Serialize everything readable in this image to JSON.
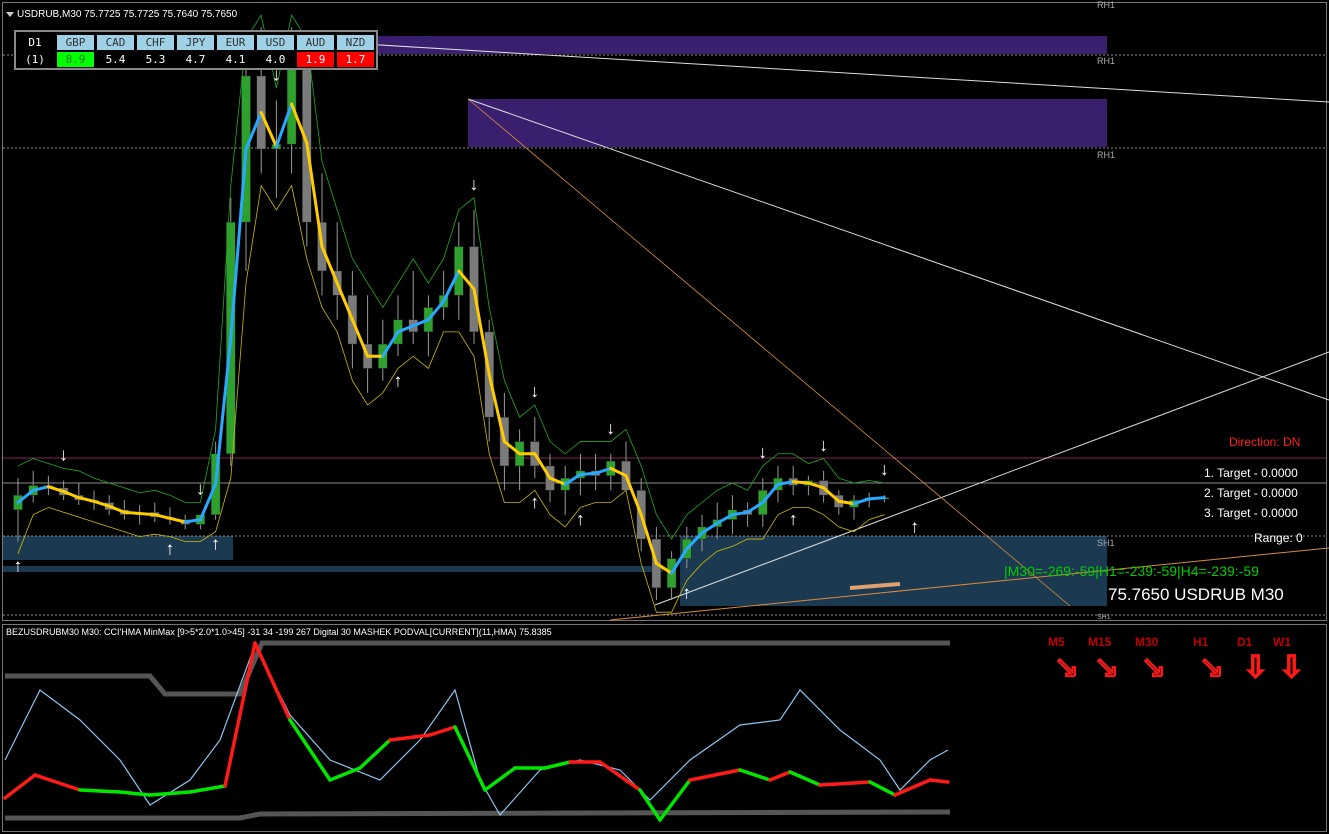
{
  "chart_header": {
    "symbol_line": "USDRUB,M30  75.7725 75.7725 75.7640 75.7650"
  },
  "strength_table": {
    "corner": "D1",
    "row_label": "(1)",
    "currencies": [
      "GBP",
      "CAD",
      "CHF",
      "JPY",
      "EUR",
      "USD",
      "AUD",
      "NZD"
    ],
    "values": [
      "8.9",
      "5.4",
      "5.3",
      "4.7",
      "4.1",
      "4.0",
      "1.9",
      "1.7"
    ],
    "colors": [
      "#00ff00",
      "",
      "",
      "",
      "",
      "",
      "#ff0000",
      "#ff0000"
    ]
  },
  "levels": {
    "rh1_a": "RH1",
    "rh1_b": "RH1",
    "rh1_c": "RH1",
    "sh1": "SH1",
    "sh1_b": "SH1"
  },
  "info_panel": {
    "direction": "Direction: DN",
    "target1": "1. Target - 0.0000",
    "target2": "2. Target - 0.0000",
    "target3": "3. Target - 0.0000",
    "range": "Range: 0",
    "mtf": "|M30=-269:-59|H1=-239:-59|H4=-239:-59",
    "price": "75.7650 USDRUB M30"
  },
  "indicator": {
    "title": "BEZUSDRUBM30  M30: CCI'HMA MinMax [9>5*2.0*1.0>45]  -31 34 -199 267  Digital 30 MASHEK PODVAL[CURRENT](11,HMA) 75.8385"
  },
  "timeframes": {
    "labels": [
      "M5",
      "M15",
      "M30",
      "H1",
      "D1",
      "W1"
    ],
    "arrows": [
      "down-right-arrow",
      "down-right-arrow",
      "down-right-arrow",
      "down-right-arrow",
      "down-arrow",
      "down-arrow"
    ]
  },
  "colors": {
    "bull_candle": "#2ea02e",
    "bear_candle": "#7a7a7a",
    "hma_up": "#29a8ff",
    "hma_down": "#ffcc00",
    "resistance_zone": "#3a1f6e",
    "support_zone": "#1b3a52",
    "cci_up": "#00e600",
    "cci_down": "#ff1a1a"
  },
  "chart_data": {
    "type": "candlestick",
    "symbol": "USDRUB",
    "timeframe": "M30",
    "candles": [
      {
        "o": 75.92,
        "h": 76.05,
        "l": 75.79,
        "c": 75.98
      },
      {
        "o": 75.98,
        "h": 76.08,
        "l": 75.95,
        "c": 76.02
      },
      {
        "o": 76.02,
        "h": 76.06,
        "l": 75.98,
        "c": 76.01
      },
      {
        "o": 76.01,
        "h": 76.04,
        "l": 75.96,
        "c": 75.98
      },
      {
        "o": 75.98,
        "h": 76.03,
        "l": 75.94,
        "c": 75.96
      },
      {
        "o": 75.96,
        "h": 76.0,
        "l": 75.92,
        "c": 75.95
      },
      {
        "o": 75.95,
        "h": 75.98,
        "l": 75.9,
        "c": 75.92
      },
      {
        "o": 75.92,
        "h": 75.96,
        "l": 75.88,
        "c": 75.9
      },
      {
        "o": 75.9,
        "h": 75.94,
        "l": 75.86,
        "c": 75.91
      },
      {
        "o": 75.91,
        "h": 75.95,
        "l": 75.87,
        "c": 75.89
      },
      {
        "o": 75.89,
        "h": 75.93,
        "l": 75.86,
        "c": 75.88
      },
      {
        "o": 75.88,
        "h": 75.9,
        "l": 75.84,
        "c": 75.86
      },
      {
        "o": 75.86,
        "h": 75.9,
        "l": 75.84,
        "c": 75.9
      },
      {
        "o": 75.9,
        "h": 76.2,
        "l": 75.88,
        "c": 76.15
      },
      {
        "o": 76.15,
        "h": 77.2,
        "l": 76.1,
        "c": 77.1
      },
      {
        "o": 77.1,
        "h": 77.8,
        "l": 76.9,
        "c": 77.7
      },
      {
        "o": 77.7,
        "h": 77.9,
        "l": 77.3,
        "c": 77.4
      },
      {
        "o": 77.4,
        "h": 77.6,
        "l": 77.2,
        "c": 77.42
      },
      {
        "o": 77.42,
        "h": 77.9,
        "l": 77.3,
        "c": 77.75
      },
      {
        "o": 77.75,
        "h": 77.8,
        "l": 77.0,
        "c": 77.1
      },
      {
        "o": 77.1,
        "h": 77.3,
        "l": 76.8,
        "c": 76.9
      },
      {
        "o": 76.9,
        "h": 77.1,
        "l": 76.7,
        "c": 76.8
      },
      {
        "o": 76.8,
        "h": 76.9,
        "l": 76.5,
        "c": 76.6
      },
      {
        "o": 76.6,
        "h": 76.8,
        "l": 76.4,
        "c": 76.5
      },
      {
        "o": 76.5,
        "h": 76.7,
        "l": 76.45,
        "c": 76.6
      },
      {
        "o": 76.6,
        "h": 76.8,
        "l": 76.55,
        "c": 76.7
      },
      {
        "o": 76.7,
        "h": 76.9,
        "l": 76.6,
        "c": 76.65
      },
      {
        "o": 76.65,
        "h": 76.8,
        "l": 76.55,
        "c": 76.75
      },
      {
        "o": 76.75,
        "h": 76.9,
        "l": 76.7,
        "c": 76.8
      },
      {
        "o": 76.8,
        "h": 77.1,
        "l": 76.7,
        "c": 77.0
      },
      {
        "o": 77.0,
        "h": 77.15,
        "l": 76.6,
        "c": 76.65
      },
      {
        "o": 76.65,
        "h": 76.7,
        "l": 76.2,
        "c": 76.3
      },
      {
        "o": 76.3,
        "h": 76.4,
        "l": 76.0,
        "c": 76.1
      },
      {
        "o": 76.1,
        "h": 76.25,
        "l": 76.0,
        "c": 76.2
      },
      {
        "o": 76.2,
        "h": 76.3,
        "l": 76.05,
        "c": 76.1
      },
      {
        "o": 76.1,
        "h": 76.15,
        "l": 75.95,
        "c": 76.0
      },
      {
        "o": 76.0,
        "h": 76.1,
        "l": 75.9,
        "c": 76.05
      },
      {
        "o": 76.05,
        "h": 76.15,
        "l": 75.98,
        "c": 76.08
      },
      {
        "o": 76.08,
        "h": 76.15,
        "l": 76.0,
        "c": 76.06
      },
      {
        "o": 76.06,
        "h": 76.15,
        "l": 76.0,
        "c": 76.12
      },
      {
        "o": 76.12,
        "h": 76.2,
        "l": 76.05,
        "c": 76.0
      },
      {
        "o": 76.0,
        "h": 76.05,
        "l": 75.75,
        "c": 75.8
      },
      {
        "o": 75.8,
        "h": 75.85,
        "l": 75.55,
        "c": 75.6
      },
      {
        "o": 75.6,
        "h": 75.75,
        "l": 75.55,
        "c": 75.72
      },
      {
        "o": 75.72,
        "h": 75.85,
        "l": 75.68,
        "c": 75.8
      },
      {
        "o": 75.8,
        "h": 75.9,
        "l": 75.75,
        "c": 75.85
      },
      {
        "o": 75.85,
        "h": 75.95,
        "l": 75.8,
        "c": 75.88
      },
      {
        "o": 75.88,
        "h": 75.98,
        "l": 75.82,
        "c": 75.92
      },
      {
        "o": 75.92,
        "h": 75.95,
        "l": 75.85,
        "c": 75.9
      },
      {
        "o": 75.9,
        "h": 76.05,
        "l": 75.85,
        "c": 76.0
      },
      {
        "o": 76.0,
        "h": 76.1,
        "l": 75.95,
        "c": 76.05
      },
      {
        "o": 76.05,
        "h": 76.1,
        "l": 75.98,
        "c": 76.02
      },
      {
        "o": 76.02,
        "h": 76.06,
        "l": 75.98,
        "c": 76.04
      },
      {
        "o": 76.04,
        "h": 76.08,
        "l": 75.95,
        "c": 75.98
      },
      {
        "o": 75.98,
        "h": 76.0,
        "l": 75.9,
        "c": 75.93
      },
      {
        "o": 75.93,
        "h": 75.98,
        "l": 75.88,
        "c": 75.96
      },
      {
        "o": 75.96,
        "h": 75.99,
        "l": 75.93,
        "c": 75.97
      },
      {
        "o": 75.97,
        "h": 75.98,
        "l": 75.95,
        "c": 75.97
      }
    ]
  }
}
